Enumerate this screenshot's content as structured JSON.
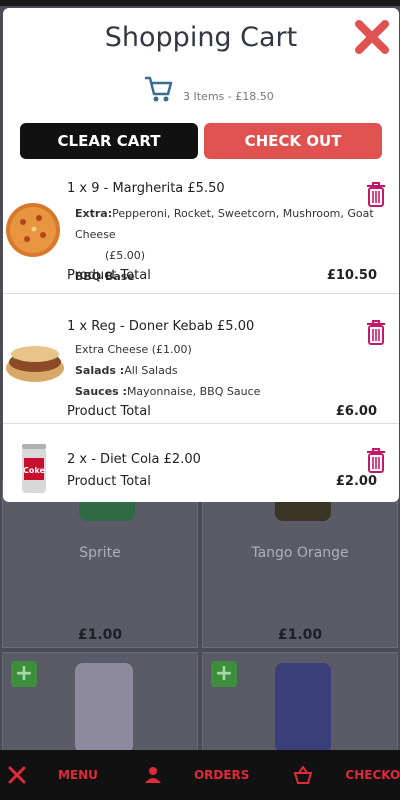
{
  "cart": {
    "title": "Shopping Cart",
    "summary": "3 Items - £18.50",
    "clear_label": "CLEAR CART",
    "checkout_label": "CHECK OUT",
    "items": [
      {
        "line": "1 x 9 - Margherita £5.50",
        "extra_label": "Extra:",
        "extra_text": "Pepperoni, Rocket, Sweetcorn, Mushroom, Goat Cheese",
        "extra_price": "(£5.00)",
        "base": "BBQ Base",
        "total_label": "Product Total",
        "total": "£10.50"
      },
      {
        "line": "1 x Reg - Doner Kebab £5.00",
        "extra": "Extra Cheese (£1.00)",
        "salads_label": "Salads :",
        "salads": "All Salads",
        "sauces_label": "Sauces :",
        "sauces": "Mayonnaise, BBQ Sauce",
        "total_label": "Product Total",
        "total": "£6.00"
      },
      {
        "line": "2 x - Diet Cola £2.00",
        "total_label": "Product Total",
        "total": "£2.00"
      }
    ]
  },
  "background": {
    "products": [
      {
        "name": "Sprite",
        "price": "£1.00"
      },
      {
        "name": "Tango Orange",
        "price": "£1.00"
      }
    ]
  },
  "nav": {
    "menu": "MENU",
    "orders": "ORDERS",
    "checkout": "CHECKOUT"
  },
  "colors": {
    "accent": "#e0293a",
    "checkout_button": "#e0524f",
    "trash": "#c2186b"
  }
}
